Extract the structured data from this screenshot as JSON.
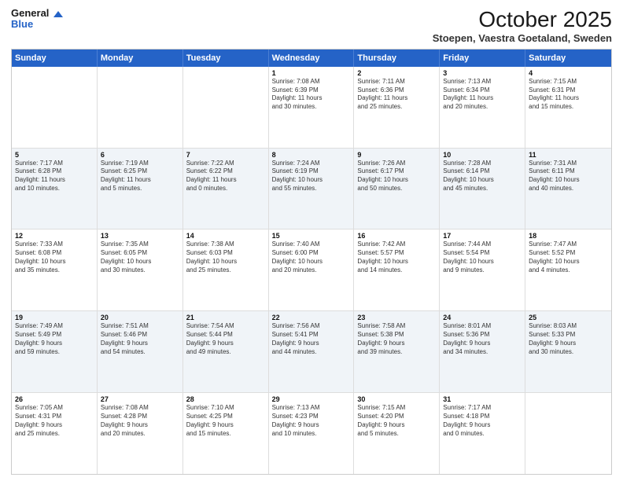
{
  "header": {
    "logo_line1": "General",
    "logo_line2": "Blue",
    "month_title": "October 2025",
    "location": "Stoepen, Vaestra Goetaland, Sweden"
  },
  "weekdays": [
    "Sunday",
    "Monday",
    "Tuesday",
    "Wednesday",
    "Thursday",
    "Friday",
    "Saturday"
  ],
  "rows": [
    [
      {
        "day": "",
        "text": ""
      },
      {
        "day": "",
        "text": ""
      },
      {
        "day": "",
        "text": ""
      },
      {
        "day": "1",
        "text": "Sunrise: 7:08 AM\nSunset: 6:39 PM\nDaylight: 11 hours\nand 30 minutes."
      },
      {
        "day": "2",
        "text": "Sunrise: 7:11 AM\nSunset: 6:36 PM\nDaylight: 11 hours\nand 25 minutes."
      },
      {
        "day": "3",
        "text": "Sunrise: 7:13 AM\nSunset: 6:34 PM\nDaylight: 11 hours\nand 20 minutes."
      },
      {
        "day": "4",
        "text": "Sunrise: 7:15 AM\nSunset: 6:31 PM\nDaylight: 11 hours\nand 15 minutes."
      }
    ],
    [
      {
        "day": "5",
        "text": "Sunrise: 7:17 AM\nSunset: 6:28 PM\nDaylight: 11 hours\nand 10 minutes."
      },
      {
        "day": "6",
        "text": "Sunrise: 7:19 AM\nSunset: 6:25 PM\nDaylight: 11 hours\nand 5 minutes."
      },
      {
        "day": "7",
        "text": "Sunrise: 7:22 AM\nSunset: 6:22 PM\nDaylight: 11 hours\nand 0 minutes."
      },
      {
        "day": "8",
        "text": "Sunrise: 7:24 AM\nSunset: 6:19 PM\nDaylight: 10 hours\nand 55 minutes."
      },
      {
        "day": "9",
        "text": "Sunrise: 7:26 AM\nSunset: 6:17 PM\nDaylight: 10 hours\nand 50 minutes."
      },
      {
        "day": "10",
        "text": "Sunrise: 7:28 AM\nSunset: 6:14 PM\nDaylight: 10 hours\nand 45 minutes."
      },
      {
        "day": "11",
        "text": "Sunrise: 7:31 AM\nSunset: 6:11 PM\nDaylight: 10 hours\nand 40 minutes."
      }
    ],
    [
      {
        "day": "12",
        "text": "Sunrise: 7:33 AM\nSunset: 6:08 PM\nDaylight: 10 hours\nand 35 minutes."
      },
      {
        "day": "13",
        "text": "Sunrise: 7:35 AM\nSunset: 6:05 PM\nDaylight: 10 hours\nand 30 minutes."
      },
      {
        "day": "14",
        "text": "Sunrise: 7:38 AM\nSunset: 6:03 PM\nDaylight: 10 hours\nand 25 minutes."
      },
      {
        "day": "15",
        "text": "Sunrise: 7:40 AM\nSunset: 6:00 PM\nDaylight: 10 hours\nand 20 minutes."
      },
      {
        "day": "16",
        "text": "Sunrise: 7:42 AM\nSunset: 5:57 PM\nDaylight: 10 hours\nand 14 minutes."
      },
      {
        "day": "17",
        "text": "Sunrise: 7:44 AM\nSunset: 5:54 PM\nDaylight: 10 hours\nand 9 minutes."
      },
      {
        "day": "18",
        "text": "Sunrise: 7:47 AM\nSunset: 5:52 PM\nDaylight: 10 hours\nand 4 minutes."
      }
    ],
    [
      {
        "day": "19",
        "text": "Sunrise: 7:49 AM\nSunset: 5:49 PM\nDaylight: 9 hours\nand 59 minutes."
      },
      {
        "day": "20",
        "text": "Sunrise: 7:51 AM\nSunset: 5:46 PM\nDaylight: 9 hours\nand 54 minutes."
      },
      {
        "day": "21",
        "text": "Sunrise: 7:54 AM\nSunset: 5:44 PM\nDaylight: 9 hours\nand 49 minutes."
      },
      {
        "day": "22",
        "text": "Sunrise: 7:56 AM\nSunset: 5:41 PM\nDaylight: 9 hours\nand 44 minutes."
      },
      {
        "day": "23",
        "text": "Sunrise: 7:58 AM\nSunset: 5:38 PM\nDaylight: 9 hours\nand 39 minutes."
      },
      {
        "day": "24",
        "text": "Sunrise: 8:01 AM\nSunset: 5:36 PM\nDaylight: 9 hours\nand 34 minutes."
      },
      {
        "day": "25",
        "text": "Sunrise: 8:03 AM\nSunset: 5:33 PM\nDaylight: 9 hours\nand 30 minutes."
      }
    ],
    [
      {
        "day": "26",
        "text": "Sunrise: 7:05 AM\nSunset: 4:31 PM\nDaylight: 9 hours\nand 25 minutes."
      },
      {
        "day": "27",
        "text": "Sunrise: 7:08 AM\nSunset: 4:28 PM\nDaylight: 9 hours\nand 20 minutes."
      },
      {
        "day": "28",
        "text": "Sunrise: 7:10 AM\nSunset: 4:25 PM\nDaylight: 9 hours\nand 15 minutes."
      },
      {
        "day": "29",
        "text": "Sunrise: 7:13 AM\nSunset: 4:23 PM\nDaylight: 9 hours\nand 10 minutes."
      },
      {
        "day": "30",
        "text": "Sunrise: 7:15 AM\nSunset: 4:20 PM\nDaylight: 9 hours\nand 5 minutes."
      },
      {
        "day": "31",
        "text": "Sunrise: 7:17 AM\nSunset: 4:18 PM\nDaylight: 9 hours\nand 0 minutes."
      },
      {
        "day": "",
        "text": ""
      }
    ]
  ],
  "alt_rows": [
    1,
    3
  ]
}
